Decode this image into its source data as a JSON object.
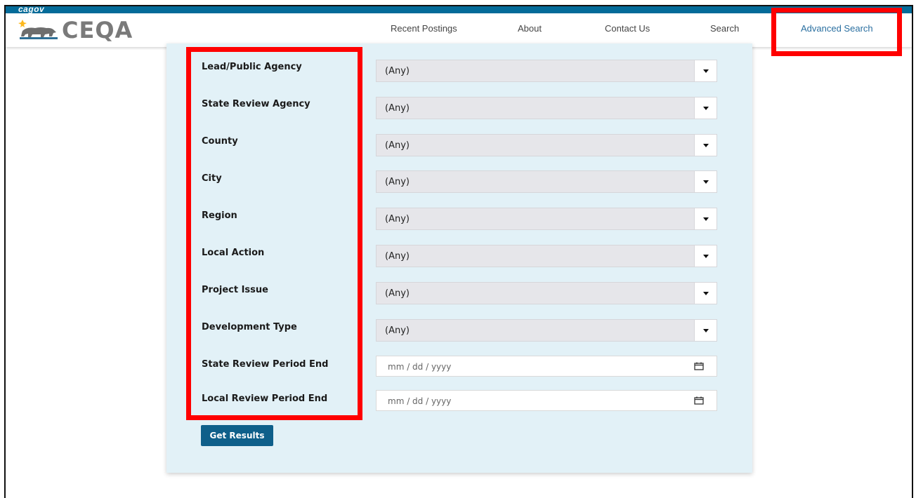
{
  "gov_logo": {
    "prefix": "ca",
    "suffix": "gov"
  },
  "brand": {
    "name": "CEQA"
  },
  "nav": {
    "items": [
      {
        "label": "Recent Postings"
      },
      {
        "label": "About"
      },
      {
        "label": "Contact Us"
      },
      {
        "label": "Search"
      },
      {
        "label": "Advanced Search"
      }
    ],
    "active": "Advanced Search"
  },
  "form": {
    "fields": [
      {
        "label": "Lead/Public Agency",
        "value": "(Any)"
      },
      {
        "label": "State Review Agency",
        "value": "(Any)"
      },
      {
        "label": "County",
        "value": "(Any)"
      },
      {
        "label": "City",
        "value": "(Any)"
      },
      {
        "label": "Region",
        "value": "(Any)"
      },
      {
        "label": "Local Action",
        "value": "(Any)"
      },
      {
        "label": "Project Issue",
        "value": "(Any)"
      },
      {
        "label": "Development Type",
        "value": "(Any)"
      }
    ],
    "dates": [
      {
        "label": "State Review Period End",
        "placeholder": "mm / dd / yyyy"
      },
      {
        "label": "Local Review Period End",
        "placeholder": "mm / dd / yyyy"
      }
    ],
    "submit_label": "Get Results"
  },
  "colors": {
    "gov_bar": "#046b99",
    "panel_bg": "#e2f1f7",
    "button_bg": "#0e5f8a",
    "highlight": "#ff0000",
    "active_nav": "#2a6fa0"
  }
}
